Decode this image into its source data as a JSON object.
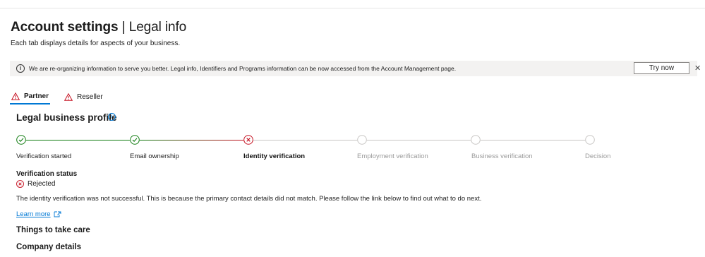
{
  "header": {
    "title": "Account settings",
    "separator": "|",
    "subtitle": "Legal info",
    "description": "Each tab displays details for aspects of your business."
  },
  "banner": {
    "icon": "info-icon",
    "text": "We are re-organizing information to serve you better. Legal info, Identifiers and Programs information can be now accessed from the Account Management page.",
    "button_label": "Try now",
    "close_icon": "close-icon"
  },
  "tabs": [
    {
      "label": "Partner",
      "icon": "warning-icon",
      "active": true
    },
    {
      "label": "Reseller",
      "icon": "warning-icon",
      "active": false
    }
  ],
  "section": {
    "title": "Legal business profile",
    "icon": "info-icon"
  },
  "steps": [
    {
      "label": "Verification started",
      "status": "done"
    },
    {
      "label": "Email ownership",
      "status": "done"
    },
    {
      "label": "Identity verification",
      "status": "failed"
    },
    {
      "label": "Employment verification",
      "status": "pending"
    },
    {
      "label": "Business verification",
      "status": "pending"
    },
    {
      "label": "Decision",
      "status": "pending"
    }
  ],
  "verification": {
    "label": "Verification status",
    "value": "Rejected",
    "message": "The identity verification was not successful. This is because the primary contact details did not match. Please follow the link below to find out what to do next.",
    "link_label": "Learn more"
  },
  "headings": {
    "things": "Things to take care",
    "company": "Company details"
  },
  "colors": {
    "accent": "#0078d4",
    "success": "#107c10",
    "error": "#c50f1f",
    "warning": "#c50f1f",
    "pending": "#c8c6c4"
  }
}
